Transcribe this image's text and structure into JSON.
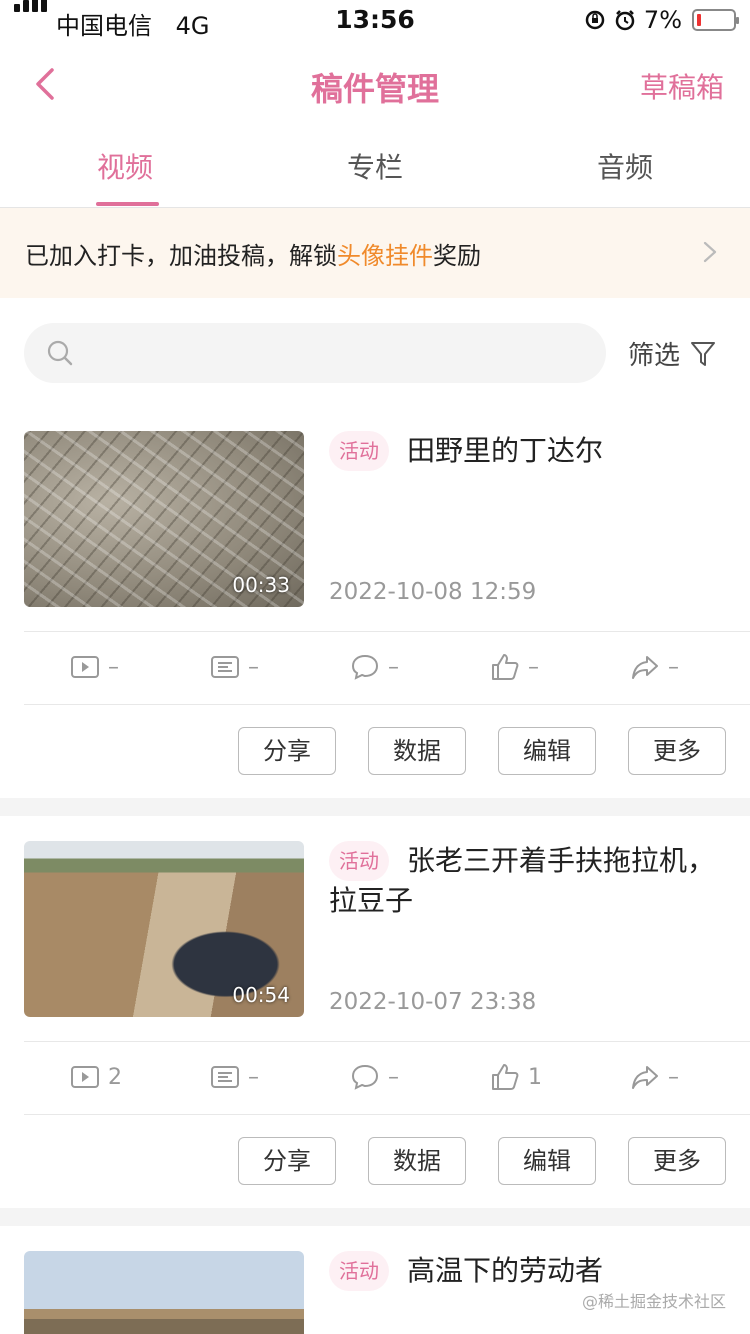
{
  "status_bar": {
    "carrier": "中国电信",
    "network": "4G",
    "time": "13:56",
    "battery": "7%",
    "battery_color": "#e33333"
  },
  "nav": {
    "back_icon": "chevron-left-icon",
    "title": "稿件管理",
    "drafts_label": "草稿箱"
  },
  "tabs": [
    {
      "label": "视频",
      "active": true
    },
    {
      "label": "专栏",
      "active": false
    },
    {
      "label": "音频",
      "active": false
    }
  ],
  "banner": {
    "text_before": "已加入打卡，加油投稿，解锁",
    "highlight": "头像挂件",
    "text_after": "奖励",
    "highlight_color": "#f08a2b"
  },
  "search": {
    "placeholder": "",
    "filter_label": "筛选"
  },
  "videos": [
    {
      "tag": "活动",
      "title": "田野里的丁达尔",
      "duration": "00:33",
      "date": "2022-10-08 12:59",
      "stats": {
        "plays": "–",
        "danmaku": "–",
        "comments": "–",
        "likes": "–",
        "shares": "–"
      }
    },
    {
      "tag": "活动",
      "title": "张老三开着手扶拖拉机，拉豆子",
      "duration": "00:54",
      "date": "2022-10-07 23:38",
      "stats": {
        "plays": "2",
        "danmaku": "–",
        "comments": "–",
        "likes": "1",
        "shares": "–"
      }
    },
    {
      "tag": "活动",
      "title": "高温下的劳动者"
    }
  ],
  "actions": {
    "share": "分享",
    "data": "数据",
    "edit": "编辑",
    "more": "更多"
  },
  "watermark": "@稀土掘金技术社区",
  "accent_color": "#e0709a"
}
